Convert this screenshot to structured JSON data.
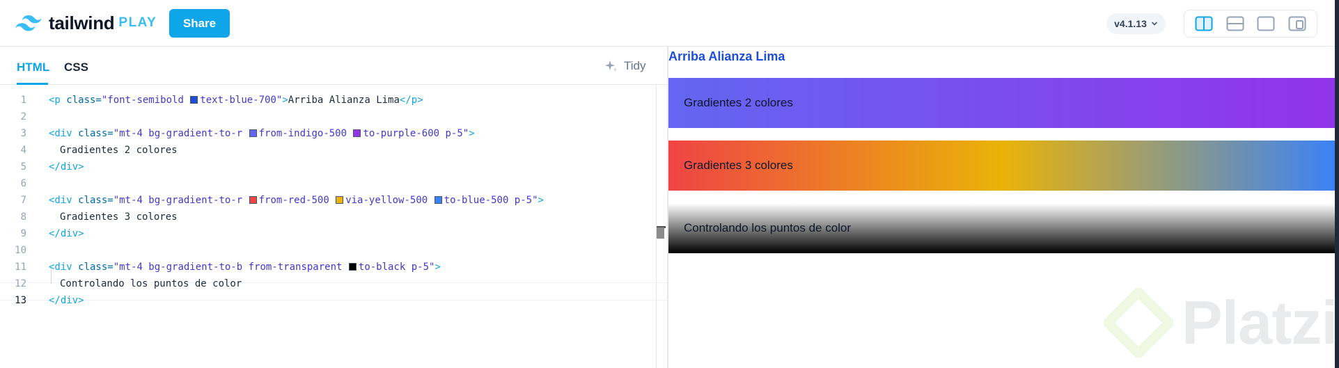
{
  "header": {
    "logo_word": "tailwind",
    "logo_play": "PLAY",
    "share_label": "Share",
    "version": "v4.1.13",
    "layout_buttons": [
      "split-vertical",
      "split-horizontal",
      "preview-only",
      "responsive"
    ]
  },
  "editor": {
    "tabs": [
      "HTML",
      "CSS"
    ],
    "active_tab": "HTML",
    "tidy_label": "Tidy",
    "active_line": 13,
    "lines": [
      {
        "n": "1"
      },
      {
        "n": "2"
      },
      {
        "n": "3"
      },
      {
        "n": "4"
      },
      {
        "n": "5"
      },
      {
        "n": "6"
      },
      {
        "n": "7"
      },
      {
        "n": "8"
      },
      {
        "n": "9"
      },
      {
        "n": "10"
      },
      {
        "n": "11"
      },
      {
        "n": "12"
      },
      {
        "n": "13"
      }
    ],
    "code": {
      "l1_open": "<p",
      "l1_attr": " class=",
      "l1_q1": "\"font-semibold ",
      "l1_c1": "text-blue-700",
      "l1_q2": "\"",
      "l1_gt": ">",
      "l1_text": "Arriba Alianza Lima",
      "l1_close": "</p>",
      "l3_open": "<div",
      "l3_attr": " class=",
      "l3_s1": "\"mt-4 bg-gradient-to-r ",
      "l3_c1": "from-indigo-500",
      "l3_c2": "to-purple-600",
      "l3_s2": " p-5\"",
      "l3_gt": ">",
      "l4_text": "Gradientes 2 colores",
      "l5_close": "</div>",
      "l7_open": "<div",
      "l7_attr": " class=",
      "l7_s1": "\"mt-4 bg-gradient-to-r ",
      "l7_c1": "from-red-500",
      "l7_c2": "via-yellow-500",
      "l7_c3": "to-blue-500",
      "l7_s2": " p-5\"",
      "l7_gt": ">",
      "l8_text": "Gradientes 3 colores",
      "l9_close": "</div>",
      "l11_open": "<div",
      "l11_attr": " class=",
      "l11_s1": "\"mt-4 bg-gradient-to-b from-transparent ",
      "l11_c1": "to-black",
      "l11_s2": " p-5\"",
      "l11_gt": ">",
      "l12_text": "Controlando los puntos de color",
      "l13_close": "</div>"
    },
    "swatch_colors": {
      "text-blue-700": "#1d4ed8",
      "from-indigo-500": "#6366f1",
      "to-purple-600": "#9333ea",
      "from-red-500": "#ef4444",
      "via-yellow-500": "#eab308",
      "to-blue-500": "#3b82f6",
      "to-black": "#000000"
    }
  },
  "preview": {
    "heading": "Arriba Alianza Lima",
    "boxes": [
      "Gradientes 2 colores",
      "Gradientes 3 colores",
      "Controlando los puntos de color"
    ],
    "watermark": "Platzi"
  },
  "colors": {
    "accent": "#0ea5e9",
    "heading_blue": "#1d4ed8"
  }
}
